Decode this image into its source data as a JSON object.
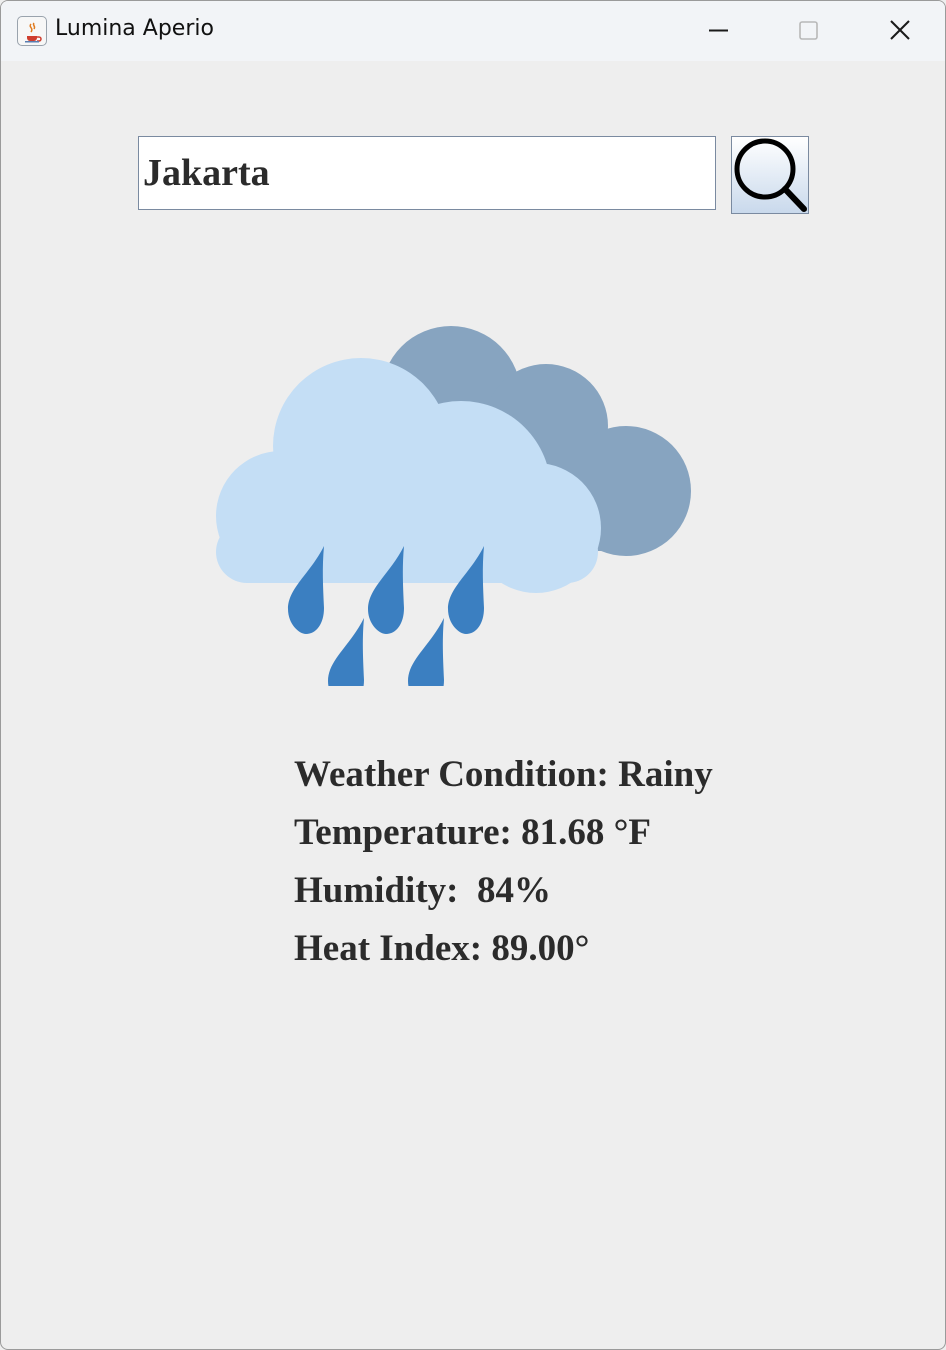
{
  "window": {
    "title": "Lumina Aperio",
    "controls": [
      "minimize-icon",
      "maximize-icon",
      "close-icon"
    ]
  },
  "search": {
    "value": "Jakarta",
    "button_icon": "search-icon"
  },
  "weather": {
    "icon": "rain-cloud-icon",
    "condition": "Weather Condition: Rainy",
    "temperature": "Temperature: 81.68 °F",
    "humidity": "Humidity:  84%",
    "heat_index": "Heat Index: 89.00°"
  },
  "colors": {
    "background": "#eeeeee",
    "text": "#2b2b2b",
    "cloud_back": "#87a4c0",
    "cloud_front": "#c4def5",
    "rain_drop": "#3b7fc1"
  }
}
